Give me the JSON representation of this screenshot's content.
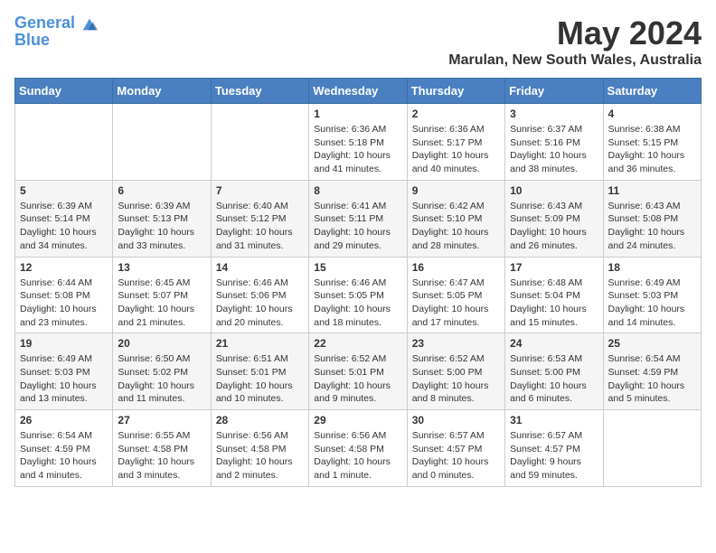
{
  "header": {
    "logo_line1": "General",
    "logo_line2": "Blue",
    "month_title": "May 2024",
    "location": "Marulan, New South Wales, Australia"
  },
  "weekdays": [
    "Sunday",
    "Monday",
    "Tuesday",
    "Wednesday",
    "Thursday",
    "Friday",
    "Saturday"
  ],
  "weeks": [
    [
      {
        "day": "",
        "info": ""
      },
      {
        "day": "",
        "info": ""
      },
      {
        "day": "",
        "info": ""
      },
      {
        "day": "1",
        "info": "Sunrise: 6:36 AM\nSunset: 5:18 PM\nDaylight: 10 hours\nand 41 minutes."
      },
      {
        "day": "2",
        "info": "Sunrise: 6:36 AM\nSunset: 5:17 PM\nDaylight: 10 hours\nand 40 minutes."
      },
      {
        "day": "3",
        "info": "Sunrise: 6:37 AM\nSunset: 5:16 PM\nDaylight: 10 hours\nand 38 minutes."
      },
      {
        "day": "4",
        "info": "Sunrise: 6:38 AM\nSunset: 5:15 PM\nDaylight: 10 hours\nand 36 minutes."
      }
    ],
    [
      {
        "day": "5",
        "info": "Sunrise: 6:39 AM\nSunset: 5:14 PM\nDaylight: 10 hours\nand 34 minutes."
      },
      {
        "day": "6",
        "info": "Sunrise: 6:39 AM\nSunset: 5:13 PM\nDaylight: 10 hours\nand 33 minutes."
      },
      {
        "day": "7",
        "info": "Sunrise: 6:40 AM\nSunset: 5:12 PM\nDaylight: 10 hours\nand 31 minutes."
      },
      {
        "day": "8",
        "info": "Sunrise: 6:41 AM\nSunset: 5:11 PM\nDaylight: 10 hours\nand 29 minutes."
      },
      {
        "day": "9",
        "info": "Sunrise: 6:42 AM\nSunset: 5:10 PM\nDaylight: 10 hours\nand 28 minutes."
      },
      {
        "day": "10",
        "info": "Sunrise: 6:43 AM\nSunset: 5:09 PM\nDaylight: 10 hours\nand 26 minutes."
      },
      {
        "day": "11",
        "info": "Sunrise: 6:43 AM\nSunset: 5:08 PM\nDaylight: 10 hours\nand 24 minutes."
      }
    ],
    [
      {
        "day": "12",
        "info": "Sunrise: 6:44 AM\nSunset: 5:08 PM\nDaylight: 10 hours\nand 23 minutes."
      },
      {
        "day": "13",
        "info": "Sunrise: 6:45 AM\nSunset: 5:07 PM\nDaylight: 10 hours\nand 21 minutes."
      },
      {
        "day": "14",
        "info": "Sunrise: 6:46 AM\nSunset: 5:06 PM\nDaylight: 10 hours\nand 20 minutes."
      },
      {
        "day": "15",
        "info": "Sunrise: 6:46 AM\nSunset: 5:05 PM\nDaylight: 10 hours\nand 18 minutes."
      },
      {
        "day": "16",
        "info": "Sunrise: 6:47 AM\nSunset: 5:05 PM\nDaylight: 10 hours\nand 17 minutes."
      },
      {
        "day": "17",
        "info": "Sunrise: 6:48 AM\nSunset: 5:04 PM\nDaylight: 10 hours\nand 15 minutes."
      },
      {
        "day": "18",
        "info": "Sunrise: 6:49 AM\nSunset: 5:03 PM\nDaylight: 10 hours\nand 14 minutes."
      }
    ],
    [
      {
        "day": "19",
        "info": "Sunrise: 6:49 AM\nSunset: 5:03 PM\nDaylight: 10 hours\nand 13 minutes."
      },
      {
        "day": "20",
        "info": "Sunrise: 6:50 AM\nSunset: 5:02 PM\nDaylight: 10 hours\nand 11 minutes."
      },
      {
        "day": "21",
        "info": "Sunrise: 6:51 AM\nSunset: 5:01 PM\nDaylight: 10 hours\nand 10 minutes."
      },
      {
        "day": "22",
        "info": "Sunrise: 6:52 AM\nSunset: 5:01 PM\nDaylight: 10 hours\nand 9 minutes."
      },
      {
        "day": "23",
        "info": "Sunrise: 6:52 AM\nSunset: 5:00 PM\nDaylight: 10 hours\nand 8 minutes."
      },
      {
        "day": "24",
        "info": "Sunrise: 6:53 AM\nSunset: 5:00 PM\nDaylight: 10 hours\nand 6 minutes."
      },
      {
        "day": "25",
        "info": "Sunrise: 6:54 AM\nSunset: 4:59 PM\nDaylight: 10 hours\nand 5 minutes."
      }
    ],
    [
      {
        "day": "26",
        "info": "Sunrise: 6:54 AM\nSunset: 4:59 PM\nDaylight: 10 hours\nand 4 minutes."
      },
      {
        "day": "27",
        "info": "Sunrise: 6:55 AM\nSunset: 4:58 PM\nDaylight: 10 hours\nand 3 minutes."
      },
      {
        "day": "28",
        "info": "Sunrise: 6:56 AM\nSunset: 4:58 PM\nDaylight: 10 hours\nand 2 minutes."
      },
      {
        "day": "29",
        "info": "Sunrise: 6:56 AM\nSunset: 4:58 PM\nDaylight: 10 hours\nand 1 minute."
      },
      {
        "day": "30",
        "info": "Sunrise: 6:57 AM\nSunset: 4:57 PM\nDaylight: 10 hours\nand 0 minutes."
      },
      {
        "day": "31",
        "info": "Sunrise: 6:57 AM\nSunset: 4:57 PM\nDaylight: 9 hours\nand 59 minutes."
      },
      {
        "day": "",
        "info": ""
      }
    ]
  ]
}
